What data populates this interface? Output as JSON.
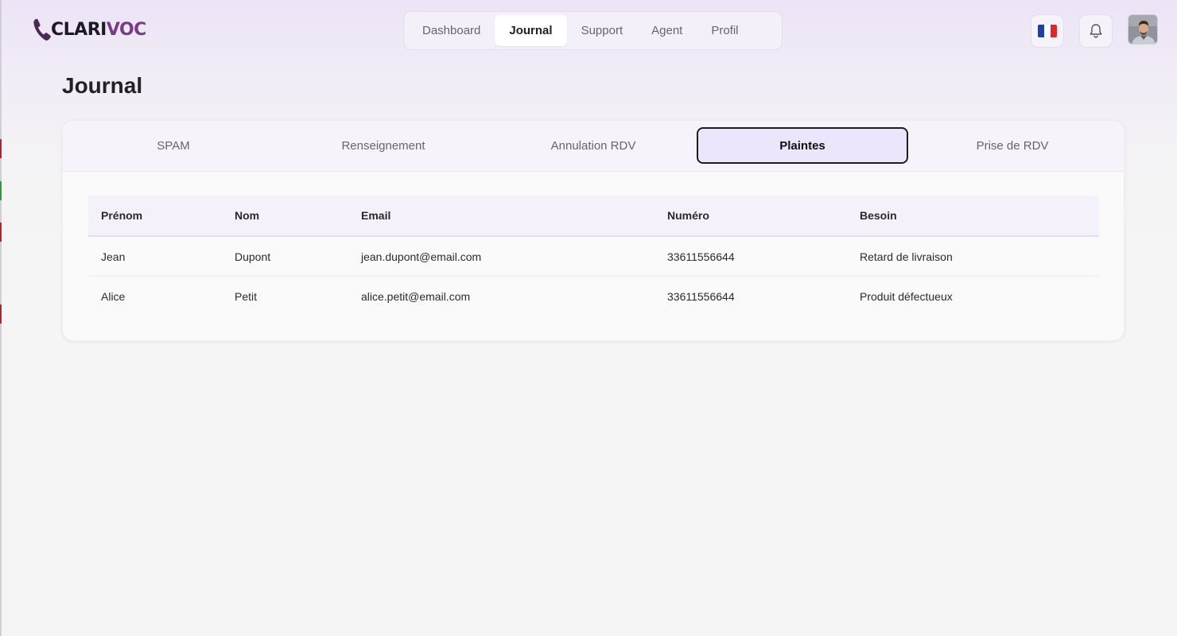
{
  "brand": {
    "name_part1": "CLARI",
    "name_part2": "VOC"
  },
  "nav": {
    "items": [
      {
        "label": "Dashboard",
        "active": false
      },
      {
        "label": "Journal",
        "active": true
      },
      {
        "label": "Support",
        "active": false
      },
      {
        "label": "Agent",
        "active": false
      },
      {
        "label": "Profil",
        "active": false
      }
    ]
  },
  "header": {
    "language_icon": "flag-france-icon",
    "notification_icon": "bell-icon",
    "avatar_icon": "user-avatar"
  },
  "page": {
    "title": "Journal"
  },
  "tabs": [
    {
      "label": "SPAM",
      "active": false
    },
    {
      "label": "Renseignement",
      "active": false
    },
    {
      "label": "Annulation RDV",
      "active": false
    },
    {
      "label": "Plaintes",
      "active": true
    },
    {
      "label": "Prise de RDV",
      "active": false
    }
  ],
  "table": {
    "columns": [
      "Prénom",
      "Nom",
      "Email",
      "Numéro",
      "Besoin"
    ],
    "rows": [
      [
        "Jean",
        "Dupont",
        "jean.dupont@email.com",
        "33611556644",
        "Retard de livraison"
      ],
      [
        "Alice",
        "Petit",
        "alice.petit@email.com",
        "33611556644",
        "Produit défectueux"
      ]
    ]
  },
  "colors": {
    "brand_dark": "#1e1a25",
    "brand_accent": "#7a3b86",
    "active_tab_bg": "#ece6fb",
    "flag_blue": "#1f3fa6",
    "flag_white": "#ffffff",
    "flag_red": "#e0262e"
  }
}
